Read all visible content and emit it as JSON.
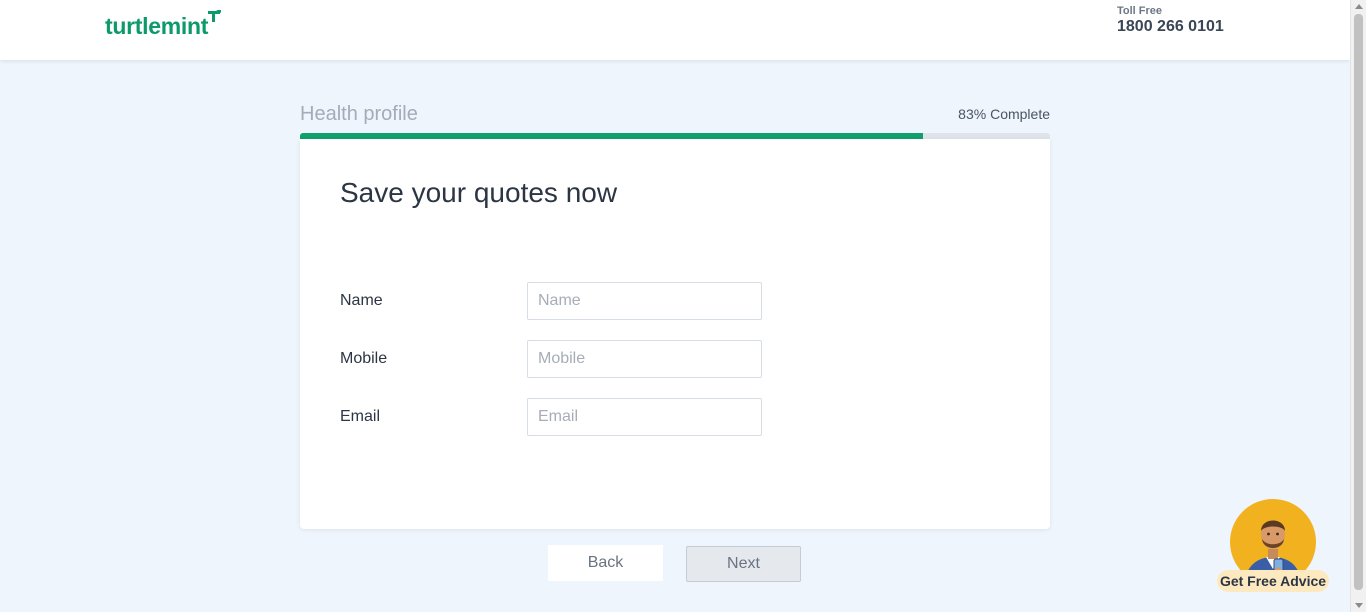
{
  "header": {
    "logo_text": "turtlemint",
    "toll_label": "Toll Free",
    "toll_number": "1800 266 0101"
  },
  "progress": {
    "section_title": "Health profile",
    "percent_label": "83% Complete",
    "percent_value": 83
  },
  "form": {
    "title": "Save your quotes now",
    "fields": [
      {
        "label": "Name",
        "placeholder": "Name",
        "value": ""
      },
      {
        "label": "Mobile",
        "placeholder": "Mobile",
        "value": ""
      },
      {
        "label": "Email",
        "placeholder": "Email",
        "value": ""
      }
    ]
  },
  "actions": {
    "back_label": "Back",
    "next_label": "Next"
  },
  "advice_widget": {
    "label": "Get Free Advice",
    "icon": "advisor-avatar-icon"
  },
  "colors": {
    "brand_green": "#0d9a6a",
    "progress_fill": "#10a06c",
    "page_bg": "#eef5fd",
    "advice_circle": "#f2b21f"
  }
}
